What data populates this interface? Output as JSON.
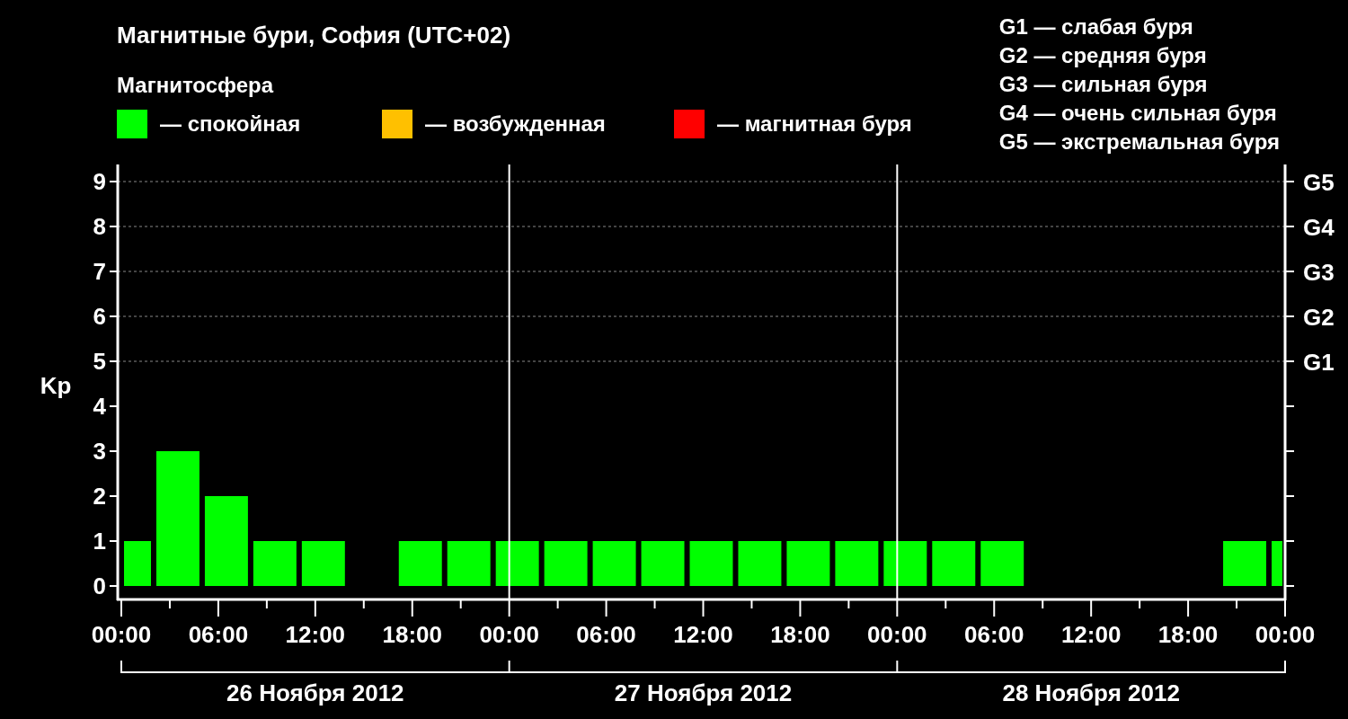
{
  "title": "Магнитные бури, София (UTC+02)",
  "legend_title": "Магнитосфера",
  "legend": [
    {
      "label": "— спокойная",
      "color": "#00ff00"
    },
    {
      "label": "— возбужденная",
      "color": "#ffc000"
    },
    {
      "label": "— магнитная буря",
      "color": "#ff0000"
    }
  ],
  "storm_scale": [
    "G1 — слабая буря",
    "G2 — средняя буря",
    "G3 — сильная буря",
    "G4 — очень сильная буря",
    "G5 — экстремальная буря"
  ],
  "storm_levels": [
    "G5",
    "G4",
    "G3",
    "G2",
    "G1"
  ],
  "chart_data": {
    "type": "bar",
    "ylabel": "Kp",
    "grid": true,
    "x": [
      "2012-11-26T01:00",
      "2012-11-26T03:30",
      "2012-11-26T06:30",
      "2012-11-26T09:30",
      "2012-11-26T12:30",
      "2012-11-26T15:30",
      "2012-11-26T18:30",
      "2012-11-26T21:30",
      "2012-11-27T00:30",
      "2012-11-27T03:30",
      "2012-11-27T06:30",
      "2012-11-27T09:30",
      "2012-11-27T12:30",
      "2012-11-27T15:30",
      "2012-11-27T18:30",
      "2012-11-27T21:30",
      "2012-11-28T00:30",
      "2012-11-28T03:30",
      "2012-11-28T06:30",
      "2012-11-28T09:30",
      "2012-11-28T12:30",
      "2012-11-28T15:30",
      "2012-11-28T18:30",
      "2012-11-28T21:30",
      "2012-11-28T23:30"
    ],
    "series": [
      {
        "color": "#00ff00",
        "values": [
          1,
          3,
          2,
          1,
          1,
          null,
          1,
          1,
          1,
          1,
          1,
          1,
          1,
          1,
          1,
          1,
          1,
          1,
          1,
          null,
          null,
          null,
          null,
          1,
          1
        ]
      }
    ],
    "xlim": [
      "2012-11-26T00:00",
      "2012-11-29T00:00"
    ],
    "ylim": [
      -0.3,
      9.38
    ],
    "xticks": [
      {
        "value": "2012-11-26T00:00",
        "label": "00:00"
      },
      {
        "value": "2012-11-26T06:00",
        "label": "06:00"
      },
      {
        "value": "2012-11-26T12:00",
        "label": "12:00"
      },
      {
        "value": "2012-11-26T18:00",
        "label": "18:00"
      },
      {
        "value": "2012-11-27T00:00",
        "label": "00:00"
      },
      {
        "value": "2012-11-27T06:00",
        "label": "06:00"
      },
      {
        "value": "2012-11-27T12:00",
        "label": "12:00"
      },
      {
        "value": "2012-11-27T18:00",
        "label": "18:00"
      },
      {
        "value": "2012-11-28T00:00",
        "label": "00:00"
      },
      {
        "value": "2012-11-28T06:00",
        "label": "06:00"
      },
      {
        "value": "2012-11-28T12:00",
        "label": "12:00"
      },
      {
        "value": "2012-11-28T18:00",
        "label": "18:00"
      },
      {
        "value": "2012-11-29T00:00",
        "label": "00:00"
      }
    ],
    "yticks": [
      0,
      1,
      2,
      3,
      4,
      5,
      6,
      7,
      8,
      9
    ]
  },
  "days": [
    "26 Ноября 2012",
    "27 Ноября 2012",
    "28 Ноября 2012"
  ]
}
